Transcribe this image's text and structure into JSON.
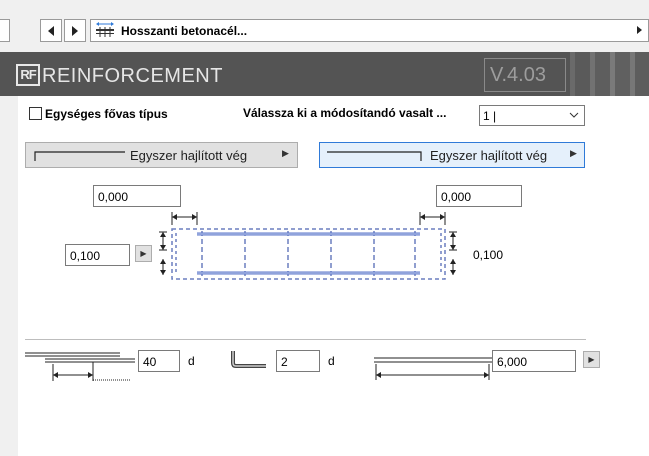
{
  "nav": {
    "prev_icon": "triangle-left",
    "next_icon": "triangle-right",
    "item_icon": "rebar-grid-icon",
    "title": "Hosszanti betonacél...",
    "dropdown_icon": "triangle-right"
  },
  "header": {
    "logo": "RF",
    "title": "REINFORCEMENT",
    "version": "V.4.03"
  },
  "options": {
    "uniform_label": "Egységes fővas típus",
    "uniform_checked": false,
    "select_label": "Válassza ki a módosítandó vasalt ...",
    "select_value": "1 |"
  },
  "end_types": {
    "left_label": "Egyszer hajlított vég",
    "right_label": "Egyszer hajlított vég"
  },
  "dimensions": {
    "top_left": "0,000",
    "top_right": "0,000",
    "side_left": "0,100",
    "side_right": "0,100"
  },
  "bottom": {
    "anchorage_value": "40",
    "anchorage_unit": "d",
    "bend_value": "2",
    "bend_unit": "d",
    "length_value": "6,000"
  },
  "colors": {
    "accent": "#2f7ad8",
    "rebar": "#5b76c8",
    "header_bg": "#4b4b4b"
  }
}
